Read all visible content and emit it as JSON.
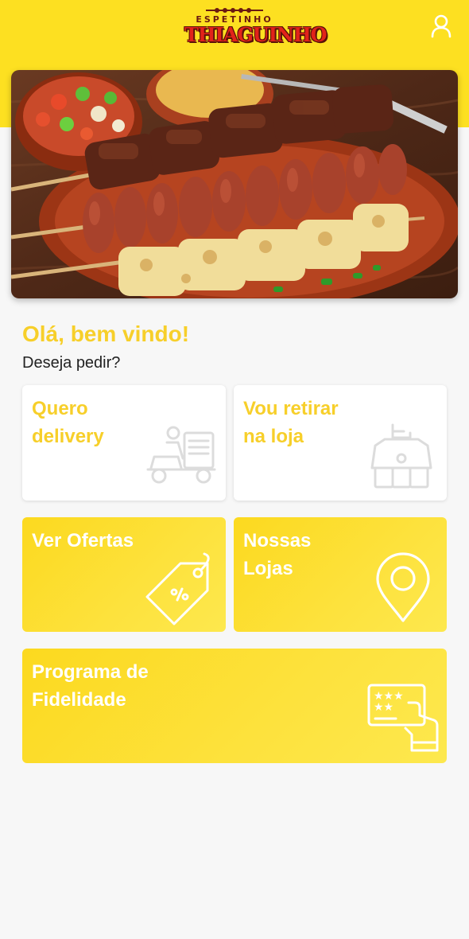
{
  "brand": {
    "logo_top": "ESPETINHO",
    "logo_main": "THIAGUINHO"
  },
  "hero": {
    "image": "grilled-skewers-photo"
  },
  "greeting": {
    "title": "Olá, bem vindo!",
    "subtitle": "Deseja pedir?"
  },
  "cards": {
    "delivery": {
      "label": "Quero\ndelivery",
      "icon": "delivery-scooter-icon"
    },
    "pickup": {
      "label": "Vou retirar\nna loja",
      "icon": "store-pickup-icon"
    },
    "offers": {
      "label": "Ver Ofertas",
      "icon": "discount-tag-icon"
    },
    "stores": {
      "label": "Nossas\nLojas",
      "icon": "map-pin-icon"
    },
    "loyalty": {
      "label": "Programa de\nFidelidade",
      "icon": "loyalty-card-icon"
    }
  },
  "colors": {
    "header_bg": "#fde021",
    "accent": "#f7cf2a",
    "card_yellow": "#fcd91f",
    "page_bg": "#f7f7f7"
  }
}
